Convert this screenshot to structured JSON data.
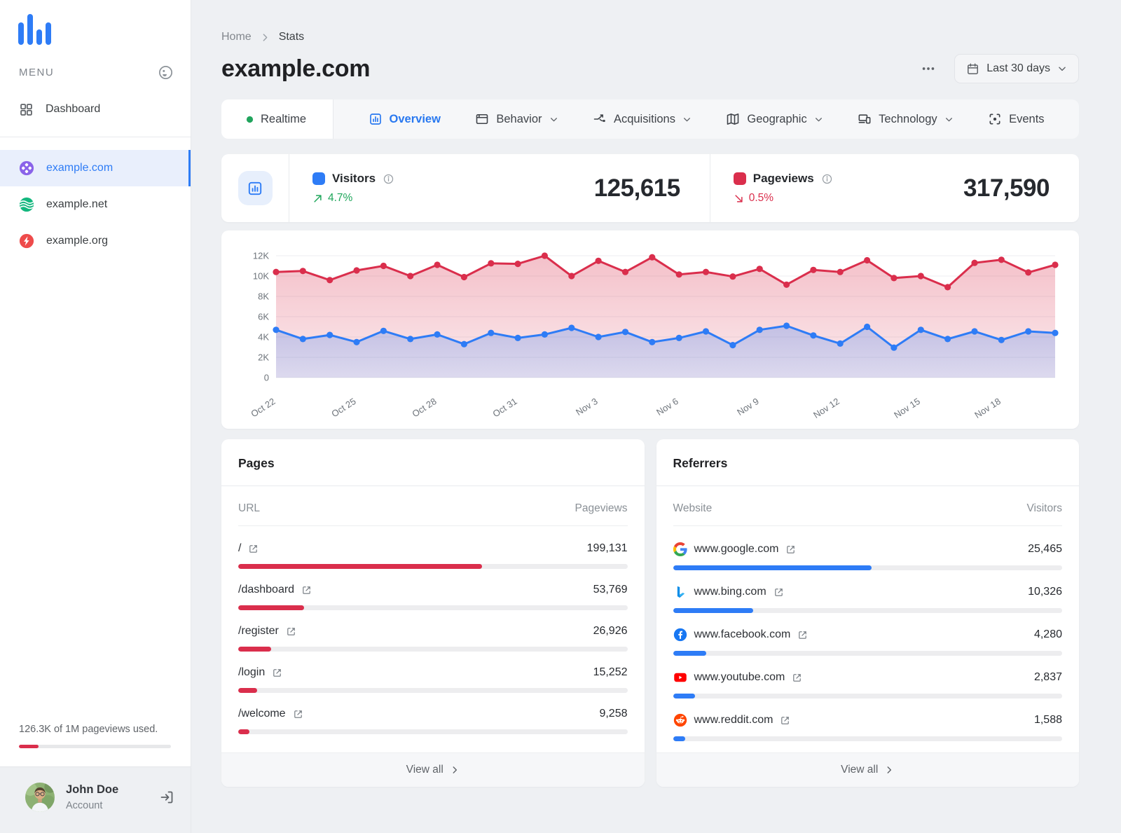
{
  "colors": {
    "accent_blue": "#2e7cf6",
    "accent_red": "#da2e4c",
    "accent_green": "#1fa65b"
  },
  "sidebar": {
    "menu_label": "MENU",
    "dashboard_label": "Dashboard",
    "sites": [
      {
        "name": "example.com",
        "icon": "clover",
        "color": "#8a63e9",
        "active": true
      },
      {
        "name": "example.net",
        "icon": "waves",
        "color": "#14b77e",
        "active": false
      },
      {
        "name": "example.org",
        "icon": "bolt",
        "color": "#ee4b4b",
        "active": false
      }
    ],
    "usage": {
      "text": "126.3K of 1M pageviews used.",
      "percent": 13
    },
    "user": {
      "name": "John Doe",
      "role": "Account"
    }
  },
  "header": {
    "breadcrumb": [
      "Home",
      "Stats"
    ],
    "title": "example.com",
    "date_range": "Last 30 days"
  },
  "tabs": [
    {
      "id": "realtime",
      "label": "Realtime",
      "active": false,
      "dropdown": false
    },
    {
      "id": "overview",
      "label": "Overview",
      "active": true,
      "dropdown": false
    },
    {
      "id": "behavior",
      "label": "Behavior",
      "active": false,
      "dropdown": true
    },
    {
      "id": "acquisitions",
      "label": "Acquisitions",
      "active": false,
      "dropdown": true
    },
    {
      "id": "geographic",
      "label": "Geographic",
      "active": false,
      "dropdown": true
    },
    {
      "id": "technology",
      "label": "Technology",
      "active": false,
      "dropdown": true
    },
    {
      "id": "events",
      "label": "Events",
      "active": false,
      "dropdown": false
    }
  ],
  "stats": {
    "visitors": {
      "label": "Visitors",
      "value": "125,615",
      "change": "4.7%",
      "trend": "up",
      "color": "#2e7cf6"
    },
    "pageviews": {
      "label": "Pageviews",
      "value": "317,590",
      "change": "0.5%",
      "trend": "down",
      "color": "#da2e4c"
    }
  },
  "chart_data": {
    "type": "line",
    "title": "Visitors and pageviews over last 30 days",
    "ylim": [
      0,
      12000
    ],
    "y_ticks": [
      "0",
      "2K",
      "4K",
      "6K",
      "8K",
      "10K",
      "12K"
    ],
    "grid": true,
    "legend_position": "none",
    "x_labels": [
      "Oct 22",
      "",
      "",
      "Oct 25",
      "",
      "",
      "Oct 28",
      "",
      "",
      "Oct 31",
      "",
      "",
      "Nov 3",
      "",
      "",
      "Nov 6",
      "",
      "",
      "Nov 9",
      "",
      "",
      "Nov 12",
      "",
      "",
      "Nov 15",
      "",
      "",
      "Nov 18",
      "",
      ""
    ],
    "series": [
      {
        "name": "Pageviews",
        "color": "#da2e4c",
        "values": [
          10400,
          10500,
          9600,
          10550,
          11000,
          10000,
          11100,
          9900,
          11250,
          11200,
          12000,
          10000,
          11500,
          10400,
          11850,
          10150,
          10400,
          9950,
          10700,
          9150,
          10600,
          10400,
          11550,
          9800,
          10000,
          8900,
          11300,
          11600,
          10350,
          11100
        ]
      },
      {
        "name": "Visitors",
        "color": "#2e7cf6",
        "values": [
          4700,
          3800,
          4200,
          3500,
          4600,
          3800,
          4250,
          3300,
          4400,
          3900,
          4250,
          4900,
          4000,
          4500,
          3500,
          3900,
          4550,
          3200,
          4700,
          5100,
          4150,
          3350,
          5000,
          2950,
          4700,
          3800,
          4550,
          3700,
          4550,
          4400
        ]
      }
    ]
  },
  "pages": {
    "title": "Pages",
    "columns": [
      "URL",
      "Pageviews"
    ],
    "bar_color": "#da2e4c",
    "rows": [
      {
        "url": "/",
        "value": "199,131",
        "percent": 62.7
      },
      {
        "url": "/dashboard",
        "value": "53,769",
        "percent": 16.9
      },
      {
        "url": "/register",
        "value": "26,926",
        "percent": 8.5
      },
      {
        "url": "/login",
        "value": "15,252",
        "percent": 4.8
      },
      {
        "url": "/welcome",
        "value": "9,258",
        "percent": 2.9
      }
    ],
    "view_all": "View all"
  },
  "referrers": {
    "title": "Referrers",
    "columns": [
      "Website",
      "Visitors"
    ],
    "bar_color": "#2e7cf6",
    "rows": [
      {
        "site": "www.google.com",
        "icon": "google",
        "value": "25,465",
        "percent": 51
      },
      {
        "site": "www.bing.com",
        "icon": "bing",
        "value": "10,326",
        "percent": 20.7
      },
      {
        "site": "www.facebook.com",
        "icon": "facebook",
        "value": "4,280",
        "percent": 8.6
      },
      {
        "site": "www.youtube.com",
        "icon": "youtube",
        "value": "2,837",
        "percent": 5.7
      },
      {
        "site": "www.reddit.com",
        "icon": "reddit",
        "value": "1,588",
        "percent": 3.2
      }
    ],
    "view_all": "View all"
  }
}
